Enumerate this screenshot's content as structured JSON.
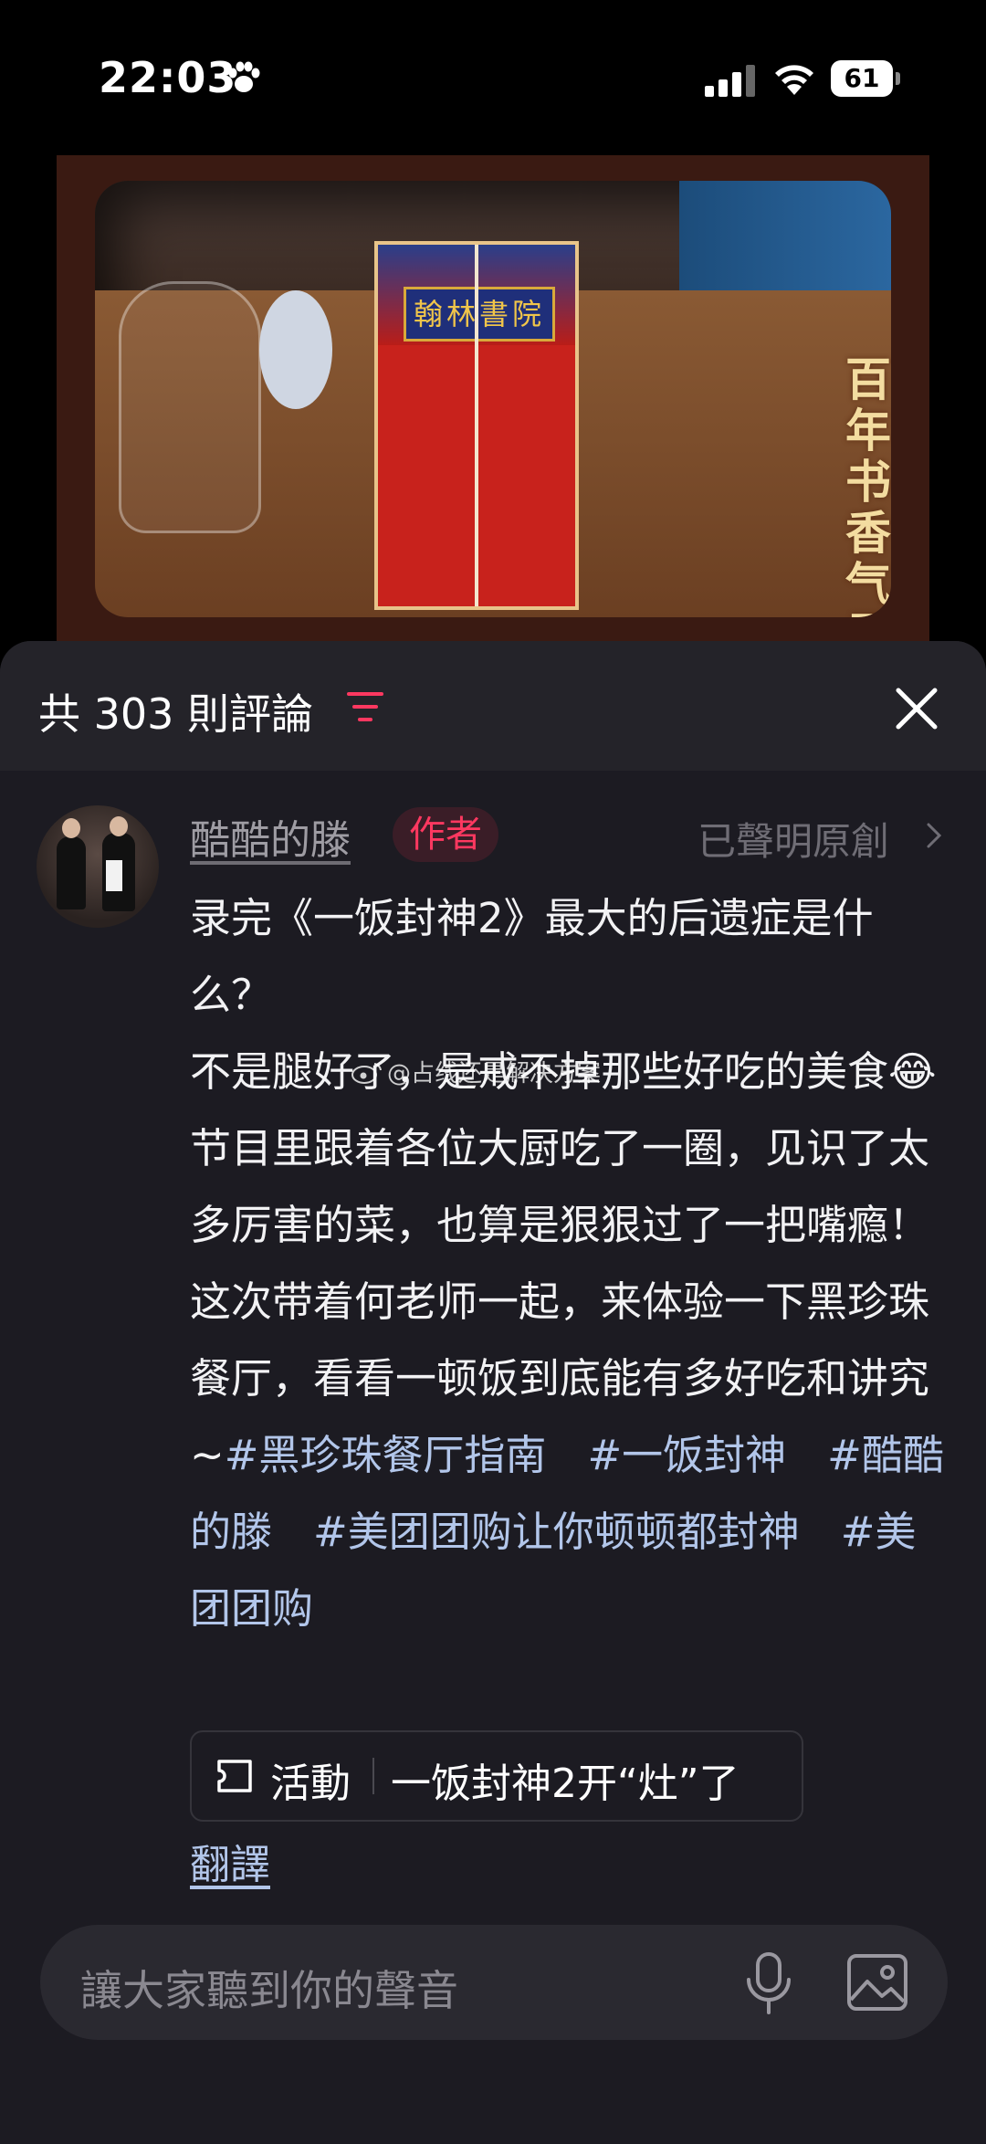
{
  "status_bar": {
    "time": "22:03",
    "battery": "61",
    "battery_fraction": 0.61
  },
  "video": {
    "caption": "百年书香气里",
    "plaque_text": "翰林書院"
  },
  "comments_panel": {
    "count_label": "共 303 則評論",
    "comment": {
      "username": "酷酷的滕",
      "author_badge": "作者",
      "original_label": "已聲明原創",
      "lines": [
        "录完《一饭封神2》最大的后遗症是什么？",
        "不是腿好了，是戒不掉那些好吃的美食😂",
        "节目里跟着各位大厨吃了一圈，见识了太多厉害的菜，也算是狠狠过了一把嘴瘾！这次带着何老师一起，来体验一下黑珍珠餐厅，看看一顿饭到底能有多好吃和讲究~"
      ],
      "hashtags": [
        "#黑珍珠餐厅指南",
        "#一饭封神",
        "#酷酷的滕",
        "#美团团购让你顿顿都封神",
        "#美团团购"
      ],
      "watermark": "@占线还是解决方案",
      "activity_label": "活動",
      "activity_title": "一饭封神2开“灶”了",
      "translate": "翻譯"
    }
  },
  "input_bar": {
    "placeholder": "讓大家聽到你的聲音"
  },
  "colors": {
    "panel_bg": "#1c1b22",
    "header_bg": "#242329",
    "accent_red": "#ff3860",
    "hashtag_blue": "#b2c6ea"
  }
}
